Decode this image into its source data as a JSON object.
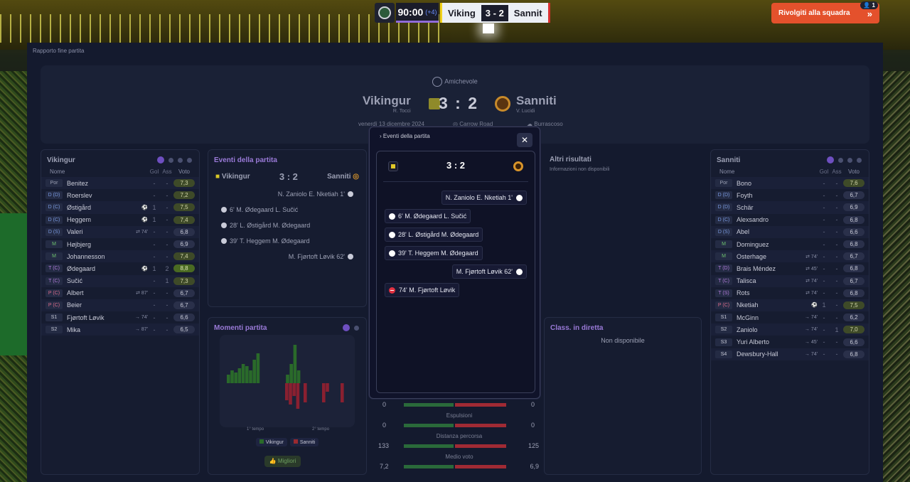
{
  "topbar": {
    "clock": "90:00",
    "added": "(+4)",
    "home": "Viking",
    "score": "3 - 2",
    "away": "Sannit"
  },
  "cta": {
    "label": "Rivolgiti alla squadra",
    "badge": "1"
  },
  "breadcrumb": "Rapporto fine partita",
  "header": {
    "competition": "Amichevole",
    "home": "Vikingur",
    "home_coach": "R. Tocci",
    "away": "Sanniti",
    "away_coach": "V. Lucidi",
    "score": "3 : 2",
    "date": "venerdì 13 dicembre 2024",
    "stadium": "Carrow Road",
    "weather": "Burrascoso"
  },
  "home_players": {
    "title": "Vikingur",
    "col_name": "Nome",
    "col_gol": "Gol",
    "col_ass": "Ass",
    "col_voto": "Voto",
    "rows": [
      {
        "pos": "Por",
        "cls": "g",
        "name": "Benitez",
        "ev": "",
        "g": "-",
        "a": "-",
        "r": "7,3",
        "rc": "mid"
      },
      {
        "pos": "D (D)",
        "cls": "d",
        "name": "Roerslev",
        "ev": "",
        "g": "-",
        "a": "-",
        "r": "7,2",
        "rc": "mid"
      },
      {
        "pos": "D (C)",
        "cls": "d",
        "name": "Østigård",
        "ev": "⚽",
        "g": "1",
        "a": "-",
        "r": "7,5",
        "rc": "mid"
      },
      {
        "pos": "D (C)",
        "cls": "d",
        "name": "Heggem",
        "ev": "⚽",
        "g": "1",
        "a": "-",
        "r": "7,4",
        "rc": "mid"
      },
      {
        "pos": "D (S)",
        "cls": "d",
        "name": "Valeri",
        "ev": "⇄ 74'",
        "g": "-",
        "a": "-",
        "r": "6,8",
        "rc": ""
      },
      {
        "pos": "M",
        "cls": "m",
        "name": "Højbjerg",
        "ev": "",
        "g": "-",
        "a": "-",
        "r": "6,9",
        "rc": ""
      },
      {
        "pos": "M",
        "cls": "m",
        "name": "Johannesson",
        "ev": "",
        "g": "-",
        "a": "-",
        "r": "7,4",
        "rc": "mid"
      },
      {
        "pos": "T (C)",
        "cls": "t",
        "name": "Ødegaard",
        "ev": "⚽",
        "g": "1",
        "a": "2",
        "r": "8,8",
        "rc": "hi"
      },
      {
        "pos": "T (C)",
        "cls": "t",
        "name": "Sučić",
        "ev": "",
        "g": "-",
        "a": "1",
        "r": "7,3",
        "rc": "mid"
      },
      {
        "pos": "P (C)",
        "cls": "p",
        "name": "Albert",
        "ev": "⇄ 87'",
        "g": "-",
        "a": "-",
        "r": "6,7",
        "rc": ""
      },
      {
        "pos": "P (C)",
        "cls": "p",
        "name": "Beier",
        "ev": "",
        "g": "-",
        "a": "-",
        "r": "6,7",
        "rc": ""
      },
      {
        "pos": "S1",
        "cls": "s",
        "name": "Fjørtoft Løvik",
        "ev": "→ 74'",
        "g": "-",
        "a": "-",
        "r": "6,6",
        "rc": ""
      },
      {
        "pos": "S2",
        "cls": "s",
        "name": "Mika",
        "ev": "→ 87'",
        "g": "-",
        "a": "-",
        "r": "6,5",
        "rc": ""
      }
    ]
  },
  "away_players": {
    "title": "Sanniti",
    "col_name": "Nome",
    "col_gol": "Gol",
    "col_ass": "Ass",
    "col_voto": "Voto",
    "rows": [
      {
        "pos": "Por",
        "cls": "g",
        "name": "Bono",
        "ev": "",
        "g": "-",
        "a": "-",
        "r": "7,6",
        "rc": "mid"
      },
      {
        "pos": "D (D)",
        "cls": "d",
        "name": "Foyth",
        "ev": "",
        "g": "-",
        "a": "-",
        "r": "6,7",
        "rc": ""
      },
      {
        "pos": "D (D)",
        "cls": "d",
        "name": "Schär",
        "ev": "",
        "g": "-",
        "a": "-",
        "r": "6,9",
        "rc": ""
      },
      {
        "pos": "D (C)",
        "cls": "d",
        "name": "Alexsandro",
        "ev": "",
        "g": "-",
        "a": "-",
        "r": "6,8",
        "rc": ""
      },
      {
        "pos": "D (S)",
        "cls": "d",
        "name": "Abel",
        "ev": "",
        "g": "-",
        "a": "-",
        "r": "6,6",
        "rc": ""
      },
      {
        "pos": "M",
        "cls": "m",
        "name": "Dominguez",
        "ev": "",
        "g": "-",
        "a": "-",
        "r": "6,8",
        "rc": ""
      },
      {
        "pos": "M",
        "cls": "m",
        "name": "Osterhage",
        "ev": "⇄ 74'",
        "g": "-",
        "a": "-",
        "r": "6,7",
        "rc": ""
      },
      {
        "pos": "T (D)",
        "cls": "t",
        "name": "Brais Méndez",
        "ev": "⇄ 45'",
        "g": "-",
        "a": "-",
        "r": "6,8",
        "rc": ""
      },
      {
        "pos": "T (C)",
        "cls": "t",
        "name": "Talisca",
        "ev": "⇄ 74'",
        "g": "-",
        "a": "-",
        "r": "6,7",
        "rc": ""
      },
      {
        "pos": "T (S)",
        "cls": "t",
        "name": "Rots",
        "ev": "⇄ 74'",
        "g": "-",
        "a": "-",
        "r": "6,8",
        "rc": ""
      },
      {
        "pos": "P (C)",
        "cls": "p",
        "name": "Nketiah",
        "ev": "⚽",
        "g": "1",
        "a": "-",
        "r": "7,5",
        "rc": "mid"
      },
      {
        "pos": "S1",
        "cls": "s",
        "name": "McGinn",
        "ev": "→ 74'",
        "g": "-",
        "a": "-",
        "r": "6,2",
        "rc": ""
      },
      {
        "pos": "S2",
        "cls": "s",
        "name": "Zaniolo",
        "ev": "→ 74'",
        "g": "-",
        "a": "1",
        "r": "7,0",
        "rc": "mid"
      },
      {
        "pos": "S3",
        "cls": "s",
        "name": "Yuri Alberto",
        "ev": "→ 45'",
        "g": "-",
        "a": "-",
        "r": "6,6",
        "rc": ""
      },
      {
        "pos": "S4",
        "cls": "s",
        "name": "Dewsbury-Hall",
        "ev": "→ 74'",
        "g": "-",
        "a": "-",
        "r": "6,8",
        "rc": ""
      }
    ]
  },
  "events_panel": {
    "title": "Eventi della partita",
    "home": "Vikingur",
    "away": "Sanniti",
    "score": "3 : 2",
    "events": [
      {
        "text": "N. Zaniolo E. Nketiah 1'",
        "side": "away"
      },
      {
        "text": "6' M. Ødegaard L. Sučić",
        "side": "home"
      },
      {
        "text": "28' L. Østigård M. Ødegaard",
        "side": "home"
      },
      {
        "text": "39' T. Heggem M. Ødegaard",
        "side": "home"
      },
      {
        "text": "M. Fjørtoft Løvik 62'",
        "side": "away"
      }
    ]
  },
  "altri": {
    "title": "Altri risultati",
    "text": "Informazioni non disponibili"
  },
  "momenti": {
    "title": "Momenti partita",
    "t1": "1° tempo",
    "t2": "2° tempo",
    "leg_home": "Vikingur",
    "leg_away": "Sanniti",
    "best": "Migliori"
  },
  "momentum": {
    "pos": [
      4,
      6,
      5,
      7,
      9,
      8,
      6,
      11,
      14,
      0,
      0,
      0,
      0,
      0,
      0,
      0,
      4,
      9,
      18,
      6,
      0,
      0,
      0,
      0,
      0,
      0,
      0,
      0
    ],
    "neg": [
      0,
      0,
      0,
      0,
      0,
      0,
      0,
      0,
      0,
      0,
      8,
      10,
      6,
      12,
      0,
      9,
      0,
      0,
      0,
      0,
      9,
      4,
      0,
      0,
      0,
      9,
      0,
      0
    ],
    "colors": {
      "home": "#2a6a2a",
      "away": "#8a2030"
    }
  },
  "class_diretta": {
    "title": "Class. in diretta",
    "text": "Non disponibile"
  },
  "stats": [
    {
      "label": "",
      "home": "0",
      "away": "0"
    },
    {
      "label": "Espulsioni",
      "home": "0",
      "away": "0"
    },
    {
      "label": "Distanza percorsa",
      "home": "133",
      "away": "125"
    },
    {
      "label": "Medio voto",
      "home": "7,2",
      "away": "6,9"
    }
  ],
  "modal": {
    "title": "Eventi della partita",
    "close": "✕",
    "score": "3 : 2",
    "events": [
      {
        "text": "N. Zaniolo E. Nketiah 1'",
        "side": "r",
        "type": "goal"
      },
      {
        "text": "6' M. Ødegaard L. Sučić",
        "side": "l",
        "type": "goal"
      },
      {
        "text": "28' L. Østigård M. Ødegaard",
        "side": "l",
        "type": "goal"
      },
      {
        "text": "39' T. Heggem M. Ødegaard",
        "side": "l",
        "type": "goal"
      },
      {
        "text": "M. Fjørtoft Løvik 62'",
        "side": "r",
        "type": "goal"
      },
      {
        "text": "74' M. Fjørtoft Løvik",
        "side": "l",
        "type": "red"
      }
    ]
  }
}
